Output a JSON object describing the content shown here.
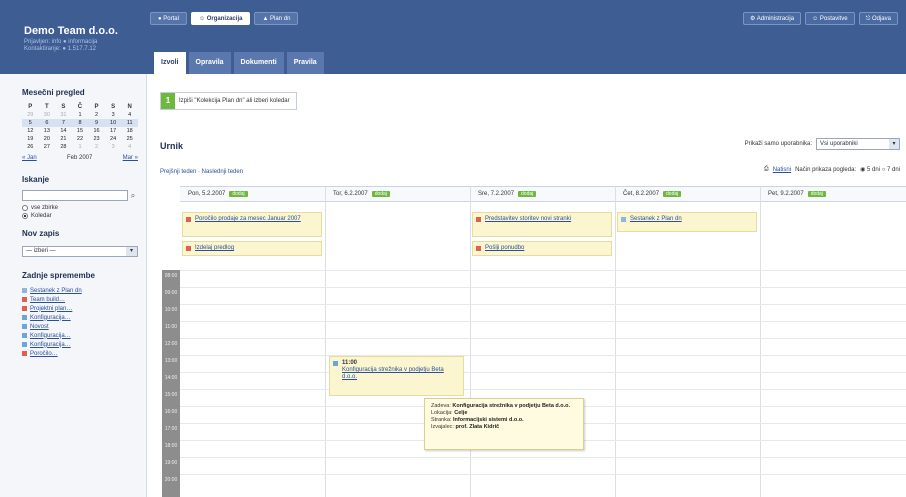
{
  "brand": {
    "name": "Demo Team d.o.o.",
    "line1": "Prijavljen: info ● informacija",
    "line2": "Kontaktiranje: ● 1.517.7.12"
  },
  "topnav": [
    {
      "label": "● Portal"
    },
    {
      "label": "☺ Organizacija"
    },
    {
      "label": "▲ Plan dn"
    }
  ],
  "topright": [
    {
      "label": "⚙ Administracija"
    },
    {
      "label": "☺ Postavitve"
    },
    {
      "label": "⎋ Odjava"
    }
  ],
  "tabs": [
    {
      "label": "Izvoli"
    },
    {
      "label": "Opravila"
    },
    {
      "label": "Dokumenti"
    },
    {
      "label": "Pravila"
    }
  ],
  "sidebar": {
    "month_title": "Mesečni pregled",
    "weekdays": [
      "P",
      "T",
      "S",
      "Č",
      "P",
      "S",
      "N"
    ],
    "weeks": [
      [
        "29",
        "30",
        "31",
        "1",
        "2",
        "3",
        "4"
      ],
      [
        "5",
        "6",
        "7",
        "8",
        "9",
        "10",
        "11"
      ],
      [
        "12",
        "13",
        "14",
        "15",
        "16",
        "17",
        "18"
      ],
      [
        "19",
        "20",
        "21",
        "22",
        "23",
        "24",
        "25"
      ],
      [
        "26",
        "27",
        "28",
        "1",
        "2",
        "3",
        "4"
      ]
    ],
    "prev": "« Jan",
    "month_label": "Feb 2007",
    "next": "Mar »",
    "search_title": "Iskanje",
    "search_value": "",
    "radio_all": "vse zbirke",
    "radio_calendar": "Koledar",
    "new_entry_title": "Nov zapis",
    "new_entry_select": "— izberi —",
    "events_title": "Zadnje spremembe",
    "events": [
      {
        "label": "Sestanek z Plan dn",
        "color": "#8db6e0"
      },
      {
        "label": "Team build…",
        "color": "#e06050"
      },
      {
        "label": "Projektni plan…",
        "color": "#e06050"
      },
      {
        "label": "Konfiguracija…",
        "color": "#6aa7d8"
      },
      {
        "label": "Novost",
        "color": "#6aa7d8"
      },
      {
        "label": "Konfiguracija…",
        "color": "#6aa7d8"
      },
      {
        "label": "Konfiguracija…",
        "color": "#6aa7d8"
      },
      {
        "label": "Poročilo…",
        "color": "#e06050"
      }
    ]
  },
  "main": {
    "hint_num": "1",
    "hint_text": "Izpiši \"Kolekcija Plan dn\" ali izberi koledar",
    "title": "Urnik",
    "perm_label": "Prikaži samo uporabnika:",
    "perm_value": "Vsi uporabniki",
    "week_nav": "Prejšnji teden · Naslednji teden",
    "print": "Natisni",
    "view_label": "Način prikaza pogleda:",
    "view_opts": "◉ 5 dni ○ 7 dni",
    "days": [
      {
        "label": "Pon, 5.2.2007",
        "badge": "dodaj"
      },
      {
        "label": "Tor, 6.2.2007",
        "badge": "dodaj"
      },
      {
        "label": "Sre, 7.2.2007",
        "badge": "dodaj"
      },
      {
        "label": "Čet, 8.2.2007",
        "badge": "dodaj"
      },
      {
        "label": "Pet, 9.2.2007",
        "badge": "dodaj"
      }
    ],
    "hours": [
      "08:00",
      "09:00",
      "10:00",
      "11:00",
      "12:00",
      "13:00",
      "14:00",
      "15:00",
      "16:00",
      "17:00",
      "18:00",
      "19:00",
      "20:00"
    ],
    "allday": [
      {
        "text": "Poročilo prodaje za mesec Januar 2007",
        "color": "#e06050"
      },
      {
        "text": "Izdelaj predlog",
        "color": "#e06050"
      },
      {
        "text": "Predstavitev storitev novi stranki",
        "color": "#e06050"
      },
      {
        "text": "Pošlji ponudbo",
        "color": "#e06050"
      },
      {
        "text": "Sestanek z Plan dn",
        "color": "#8db6e0"
      }
    ],
    "timed": {
      "time": "11:00",
      "text": "Konfiguracija strežnika v podjetju Beta d.o.o.",
      "color": "#6aa7d8"
    },
    "tooltip": {
      "l1k": "Zadeva:",
      "l1v": "Konfiguracija strežnika v podjetju Beta d.o.o.",
      "l2k": "Lokacija:",
      "l2v": "Celje",
      "l3k": "Stranka:",
      "l3v": "Informacijski sistemi d.o.o.",
      "l4k": "Izvajalec:",
      "l4v": "prof. Zlata Kidrič"
    }
  }
}
